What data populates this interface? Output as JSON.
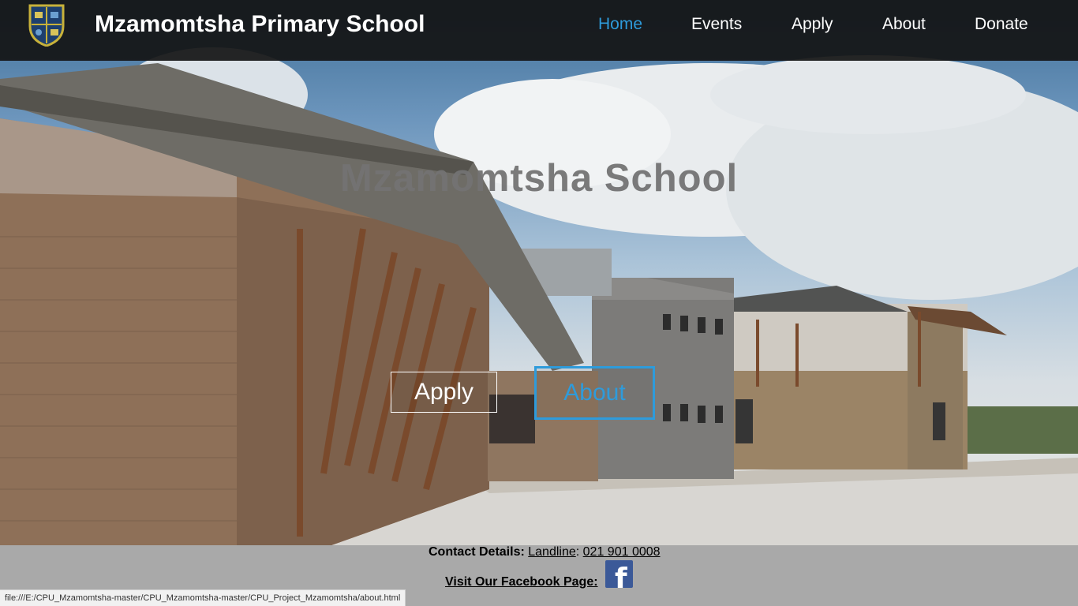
{
  "nav": {
    "site_title": "Mzamomtsha Primary School",
    "links": [
      {
        "label": "Home",
        "active": true
      },
      {
        "label": "Events",
        "active": false
      },
      {
        "label": "Apply",
        "active": false
      },
      {
        "label": "About",
        "active": false
      },
      {
        "label": "Donate",
        "active": false
      }
    ],
    "logo_icon": "school-crest-icon"
  },
  "hero": {
    "heading": "Mzamomtsha School",
    "apply_label": "Apply",
    "about_label": "About"
  },
  "footer": {
    "contact_heading": "Contact Details:",
    "landline_label": "Landline",
    "colon": ":",
    "landline_number": "021 901 0008",
    "facebook_label": "Visit Our Facebook Page:",
    "facebook_icon": "facebook-icon"
  },
  "statusbar": {
    "url": "file:///E:/CPU_Mzamomtsha-master/CPU_Mzamomtsha-master/CPU_Project_Mzamomtsha/about.html"
  },
  "colors": {
    "accent": "#2e9bdb",
    "navbar": "#141414",
    "footer": "#a9a9a9",
    "facebook": "#3b5998"
  }
}
